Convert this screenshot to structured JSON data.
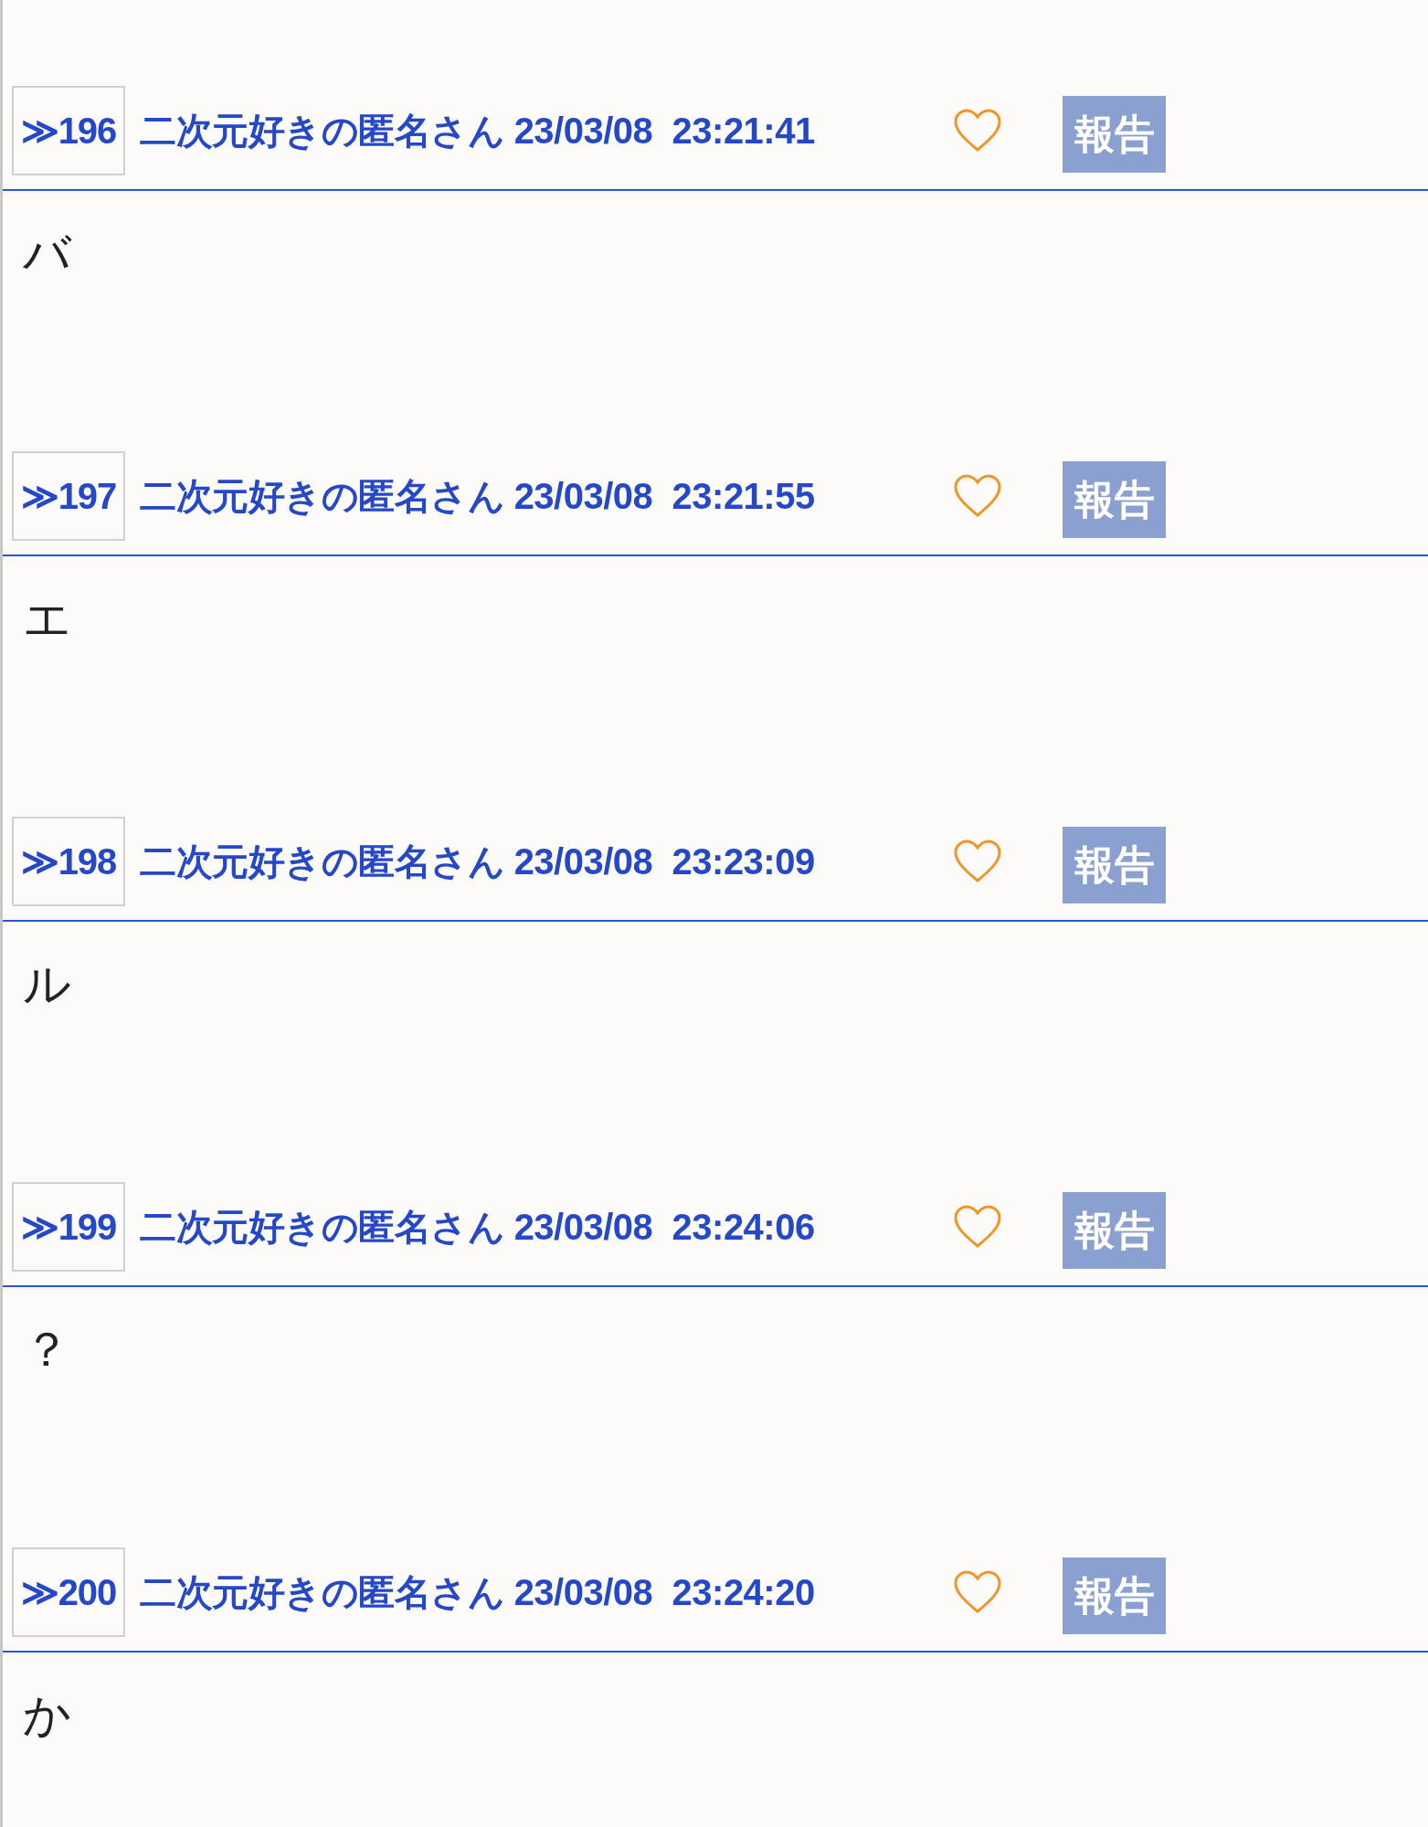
{
  "posts": [
    {
      "number": "≫196",
      "author": "二次元好きの匿名さん",
      "date": "23/03/08",
      "time": "23:21:41",
      "report": "報告",
      "body": "バ"
    },
    {
      "number": "≫197",
      "author": "二次元好きの匿名さん",
      "date": "23/03/08",
      "time": "23:21:55",
      "report": "報告",
      "body": "エ"
    },
    {
      "number": "≫198",
      "author": "二次元好きの匿名さん",
      "date": "23/03/08",
      "time": "23:23:09",
      "report": "報告",
      "body": "ル"
    },
    {
      "number": "≫199",
      "author": "二次元好きの匿名さん",
      "date": "23/03/08",
      "time": "23:24:06",
      "report": "報告",
      "body": "？"
    },
    {
      "number": "≫200",
      "author": "二次元好きの匿名さん",
      "date": "23/03/08",
      "time": "23:24:20",
      "report": "報告",
      "body": "か"
    }
  ]
}
